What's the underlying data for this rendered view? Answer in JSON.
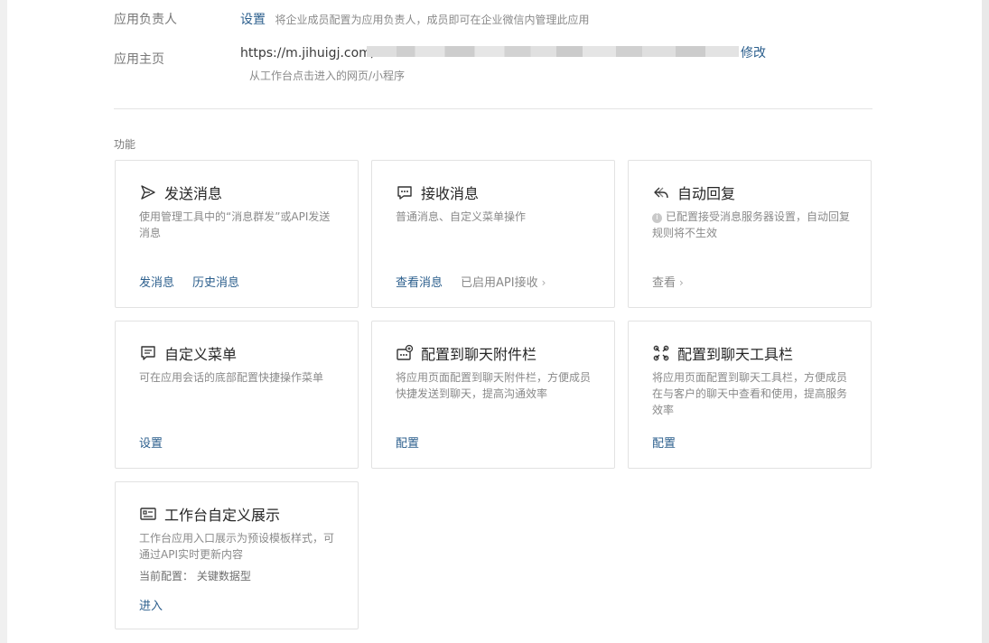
{
  "owner": {
    "label": "应用负责人",
    "set_link": "设置",
    "hint": "将企业成员配置为应用负责人，成员即可在企业微信内管理此应用"
  },
  "homepage": {
    "label": "应用主页",
    "url": "https://m.jihuigj.com/",
    "edit_link": "修改",
    "hint": "从工作台点击进入的网页/小程序"
  },
  "section_title": "功能",
  "cards": [
    {
      "icon": "send-icon",
      "title": "发送消息",
      "desc": "使用管理工具中的“消息群发”或API发送消息",
      "actions": [
        "发消息",
        "历史消息"
      ]
    },
    {
      "icon": "chat-bubble-icon",
      "title": "接收消息",
      "desc": "普通消息、自定义菜单操作",
      "actions": [
        "查看消息"
      ],
      "status": "已启用API接收"
    },
    {
      "icon": "reply-icon",
      "title": "自动回复",
      "desc": "已配置接受消息服务器设置，自动回复规则将不生效",
      "actions": [
        "查看"
      ]
    },
    {
      "icon": "menu-icon",
      "title": "自定义菜单",
      "desc": "可在应用会话的底部配置快捷操作菜单",
      "actions": [
        "设置"
      ]
    },
    {
      "icon": "attachment-bar-icon",
      "title": "配置到聊天附件栏",
      "desc": "将应用页面配置到聊天附件栏，方便成员快捷发送到聊天，提高沟通效率",
      "actions": [
        "配置"
      ]
    },
    {
      "icon": "toolbar-icon",
      "title": "配置到聊天工具栏",
      "desc": "将应用页面配置到聊天工具栏，方便成员在与客户的聊天中查看和使用，提高服务效率",
      "actions": [
        "配置"
      ]
    },
    {
      "icon": "workbench-display-icon",
      "title": "工作台自定义展示",
      "desc": "工作台应用入口展示为预设模板样式，可通过API实时更新内容",
      "current_config": "当前配置： 关键数据型",
      "actions": [
        "进入"
      ]
    }
  ]
}
